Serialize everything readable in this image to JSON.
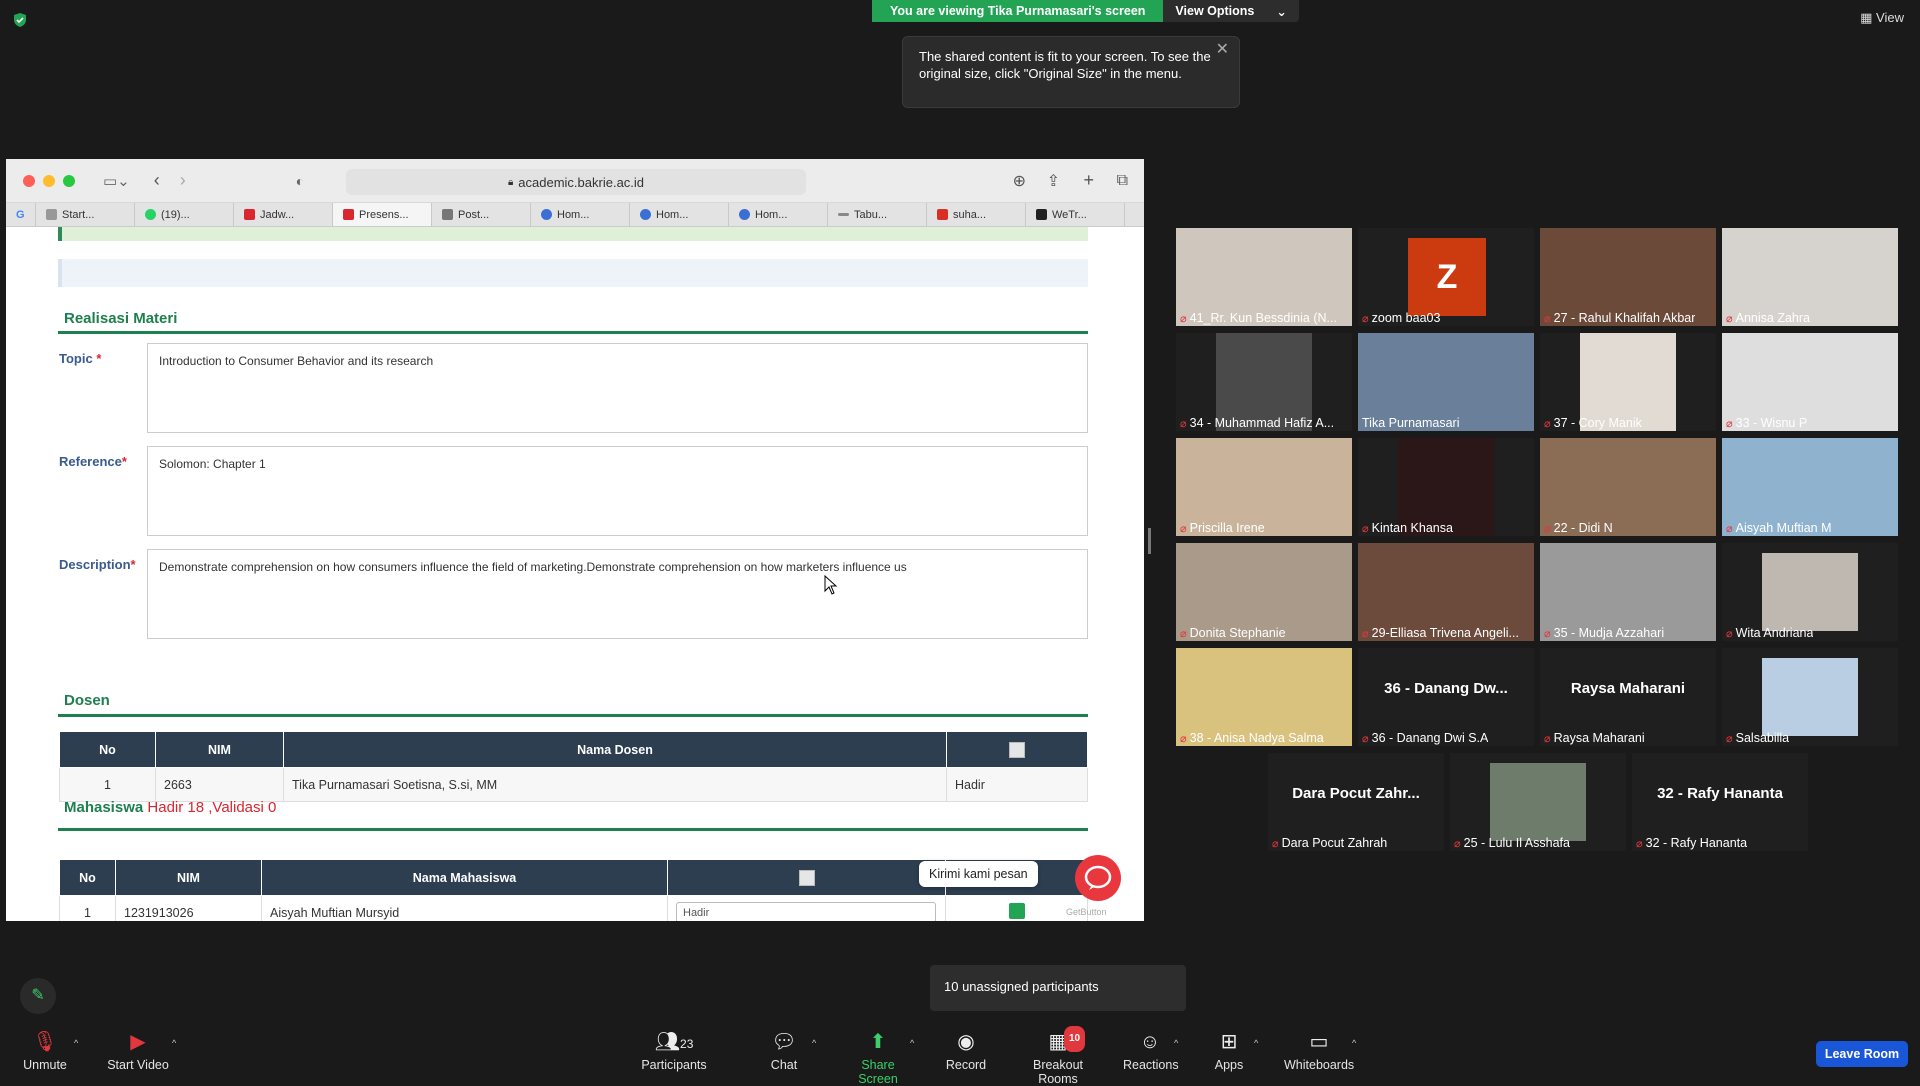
{
  "top_banner": {
    "viewing": "You are viewing Tika Purnamasari's screen",
    "view_options": "View Options"
  },
  "tooltip": {
    "text": "The shared content is fit to your screen. To see the original size, click \"Original Size\" in the menu."
  },
  "view_button": "View",
  "browser": {
    "url": "academic.bakrie.ac.id",
    "tabs": [
      "Start...",
      "(19)...",
      "Jadw...",
      "Presens...",
      "Post...",
      "Hom...",
      "Hom...",
      "Hom...",
      "Tabu...",
      "suha...",
      "WeTr..."
    ],
    "page": {
      "section_materi": "Realisasi Materi",
      "topic_label": "Topic",
      "topic_value": "Introduction to Consumer Behavior and its research",
      "reference_label": "Reference",
      "reference_value": "Solomon: Chapter 1",
      "description_label": "Description",
      "description_value": "Demonstrate comprehension on how consumers influence the field of marketing.Demonstrate comprehension on how marketers influence us",
      "required_mark": "*",
      "section_dosen": "Dosen",
      "dosen_table": {
        "headers": [
          "No",
          "NIM",
          "Nama Dosen"
        ],
        "rows": [
          {
            "no": "1",
            "nim": "2663",
            "nama": "Tika Purnamasari Soetisna, S.si, MM",
            "status": "Hadir"
          }
        ]
      },
      "mahasiswa_label": "Mahasiswa",
      "hadir_text": "Hadir 18",
      "validasi_text": ",Validasi 0",
      "mhs_table": {
        "headers": [
          "No",
          "NIM",
          "Nama Mahasiswa"
        ],
        "rows": [
          {
            "no": "1",
            "nim": "1231913026",
            "nama": "Aisyah Muftian Mursyid",
            "status": "Hadir"
          }
        ]
      },
      "chat_bubble": "Kirimi kami pesan",
      "getbutton": "GetButton"
    }
  },
  "participants": [
    {
      "name": "41_Rr. Kun Bessdinia (N...",
      "color": "#cfc7bd"
    },
    {
      "name": "zoom baa03",
      "initial": "Z"
    },
    {
      "name": "27 - Rahul Khalifah Akbar",
      "color": "#6b4a3a"
    },
    {
      "name": "Annisa Zahra",
      "color": "#d6d3cf"
    },
    {
      "name": "34 - Muhammad Hafiz A...",
      "color": "#4a4a4a"
    },
    {
      "name": "Tika Purnamasari",
      "color": "#6a7f99"
    },
    {
      "name": "37 - Cory Manik",
      "color": "#e1dbd3"
    },
    {
      "name": "33 - Wisnu P",
      "color": "#dedede"
    },
    {
      "name": "Priscilla Irene",
      "color": "#c9b49b"
    },
    {
      "name": "Kintan Khansa",
      "color": "#2b1618"
    },
    {
      "name": "22 - Didi N",
      "color": "#8b6c55"
    },
    {
      "name": "Aisyah Muftian M",
      "color": "#8fb3cf"
    },
    {
      "name": "Donita Stephanie",
      "color": "#a99a8a"
    },
    {
      "name": "29-Elliasa Trivena Angeli...",
      "color": "#6d4b3c"
    },
    {
      "name": "35 - Mudja Azzahari",
      "color": "#9a9a9a"
    },
    {
      "name": "Wita Andriana",
      "color": "#bfb8b0"
    },
    {
      "name": "38 - Anisa Nadya Salma",
      "color": "#d9c17e"
    },
    {
      "name": "36 - Danang Dwi S.A",
      "big": "36 - Danang Dw..."
    },
    {
      "name": "Raysa Maharani",
      "big": "Raysa Maharani"
    },
    {
      "name": "Salsabilla",
      "color": "#b9cde3"
    },
    {
      "name": "Dara Pocut Zahrah",
      "big": "Dara Pocut Zahr..."
    },
    {
      "name": "25 - Lulu Il Asshafa",
      "color": "#6e7d6b"
    },
    {
      "name": "32 - Rafy Hananta",
      "big": "32 - Rafy Hananta"
    }
  ],
  "unassigned": "10 unassigned participants",
  "toolbar": {
    "unmute": "Unmute",
    "start_video": "Start Video",
    "participants": "Participants",
    "participants_count": "23",
    "chat": "Chat",
    "share_screen": "Share Screen",
    "record": "Record",
    "breakout_rooms": "Breakout Rooms",
    "breakout_badge": "10",
    "reactions": "Reactions",
    "apps": "Apps",
    "whiteboards": "Whiteboards",
    "leave": "Leave Room"
  },
  "colors": {
    "share_green": "#23a455",
    "leave_blue": "#1a56d8",
    "section_green": "#1e7f4f",
    "muted_red": "#e0383d"
  }
}
